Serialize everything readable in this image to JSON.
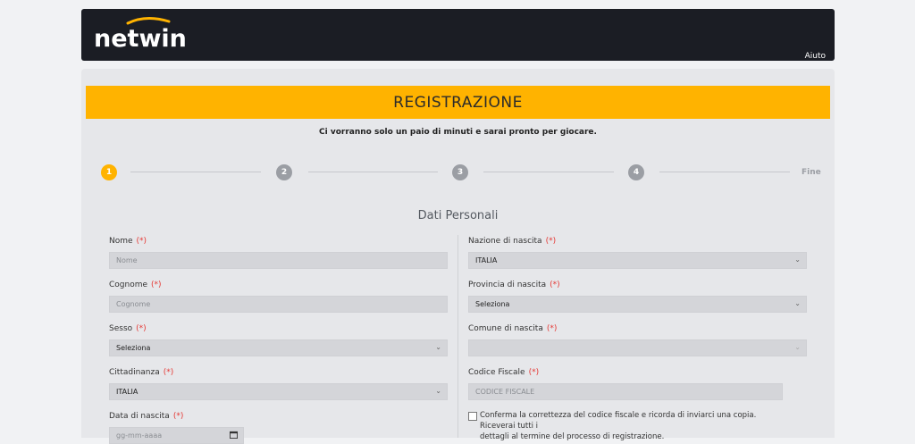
{
  "header": {
    "logo_text": "netwin",
    "help_link": "Aiuto"
  },
  "banner": {
    "title": "REGISTRAZIONE"
  },
  "subtitle": "Ci vorranno solo un paio di minuti e sarai pronto per giocare.",
  "steps": {
    "items": [
      "1",
      "2",
      "3",
      "4"
    ],
    "end_label": "Fine",
    "active_color": "#ffb300",
    "inactive_color": "#9b9ea4"
  },
  "section_title": "Dati Personali",
  "required_mark": "(*)",
  "left_fields": {
    "nome": {
      "label": "Nome",
      "placeholder": "Nome"
    },
    "cognome": {
      "label": "Cognome",
      "placeholder": "Cognome"
    },
    "sesso": {
      "label": "Sesso",
      "value": "Seleziona"
    },
    "cittadinanza": {
      "label": "Cittadinanza",
      "value": "ITALIA"
    },
    "data_nascita": {
      "label": "Data di nascita",
      "placeholder": "gg-mm-aaaa"
    }
  },
  "right_fields": {
    "nazione": {
      "label": "Nazione di nascita",
      "value": "ITALIA"
    },
    "provincia": {
      "label": "Provincia di nascita",
      "value": "Seleziona"
    },
    "comune": {
      "label": "Comune di nascita",
      "value": ""
    },
    "codice_fiscale": {
      "label": "Codice Fiscale",
      "placeholder": "CODICE FISCALE"
    }
  },
  "confirm_checkbox": {
    "line1": "Conferma la correttezza del codice fiscale e ricorda di inviarci una copia. Riceverai tutti i",
    "line2": "dettagli al termine del processo di registrazione."
  },
  "colors": {
    "accent": "#ffb300",
    "topbar": "#1b1d24",
    "required": "#e53935"
  }
}
